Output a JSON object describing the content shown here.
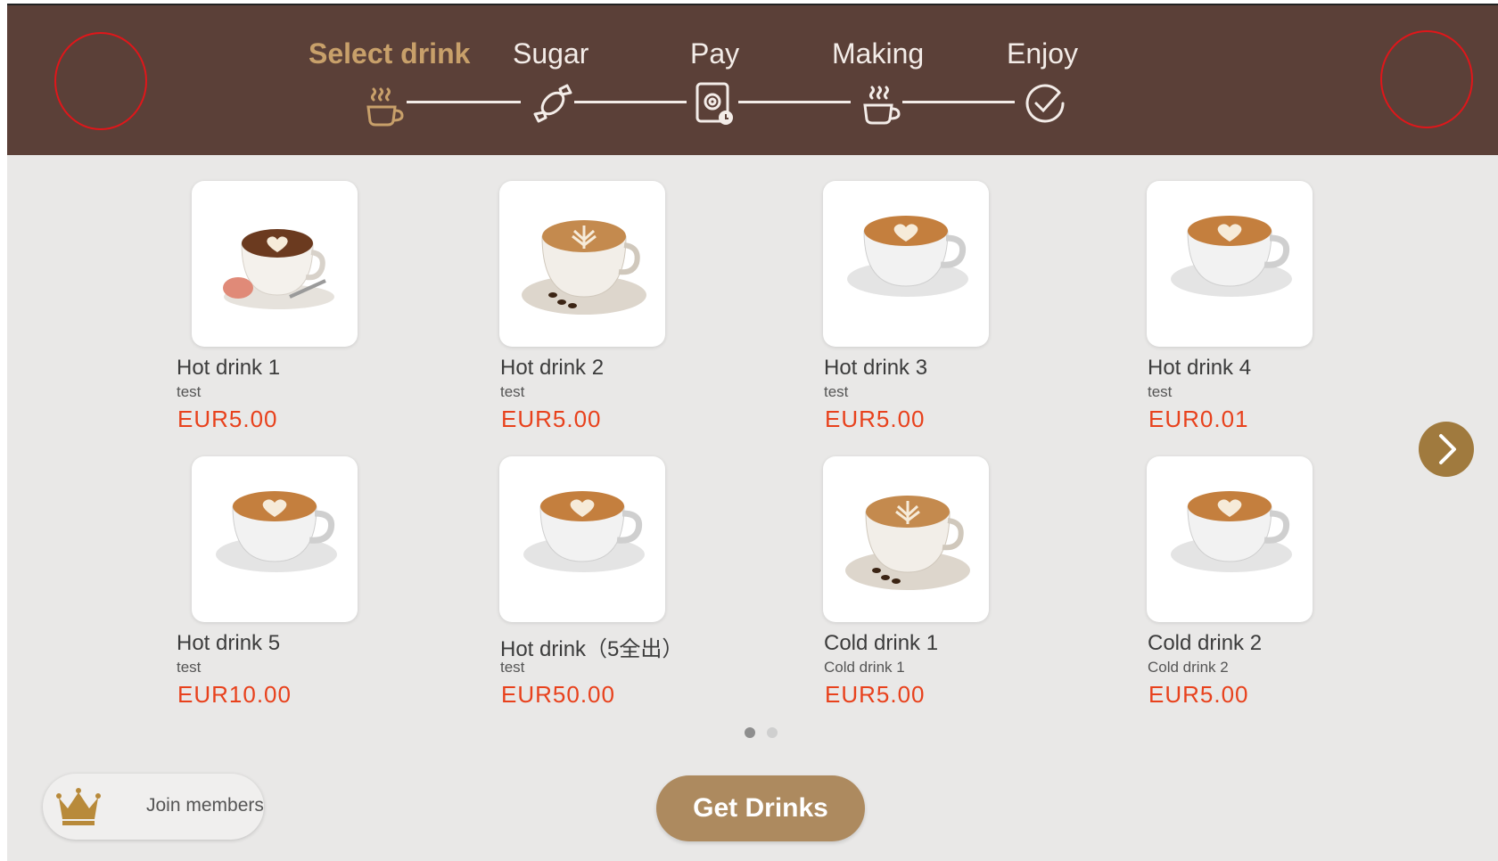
{
  "steps": [
    {
      "label": "Select drink",
      "icon": "steaming-cup-icon",
      "active": true
    },
    {
      "label": "Sugar",
      "icon": "candy-icon",
      "active": false
    },
    {
      "label": "Pay",
      "icon": "payment-scan-icon",
      "active": false
    },
    {
      "label": "Making",
      "icon": "brewing-cup-icon",
      "active": false
    },
    {
      "label": "Enjoy",
      "icon": "check-circle-icon",
      "active": false
    }
  ],
  "products": [
    {
      "name": "Hot drink 1",
      "desc": "test",
      "price": "EUR5.00",
      "image": "latte-heart-with-macaron"
    },
    {
      "name": "Hot drink 2",
      "desc": "test",
      "price": "EUR5.00",
      "image": "latte-fern-with-beans"
    },
    {
      "name": "Hot drink 3",
      "desc": "test",
      "price": "EUR5.00",
      "image": "latte-heart-white-cup"
    },
    {
      "name": "Hot drink 4",
      "desc": "test",
      "price": "EUR0.01",
      "image": "latte-heart-white-cup"
    },
    {
      "name": "Hot drink 5",
      "desc": "test",
      "price": "EUR10.00",
      "image": "latte-heart-white-cup"
    },
    {
      "name": "Hot drink（5全出）",
      "desc": "test",
      "price": "EUR50.00",
      "image": "latte-heart-white-cup"
    },
    {
      "name": "Cold drink 1",
      "desc": "Cold drink 1",
      "price": "EUR5.00",
      "image": "latte-fern-with-beans"
    },
    {
      "name": "Cold drink 2",
      "desc": "Cold drink 2",
      "price": "EUR5.00",
      "image": "latte-heart-white-cup"
    }
  ],
  "pagination": {
    "pages": 2,
    "current": 1
  },
  "next_icon": "chevron-right-icon",
  "members": {
    "label": "Join members",
    "icon": "crown-icon"
  },
  "get_drinks": {
    "label": "Get Drinks"
  },
  "colors": {
    "header_bg": "#5b4038",
    "active_step": "#c8a06a",
    "price": "#e8411c",
    "button_gold": "#ad8a5f",
    "next_button": "#a07a3e",
    "highlight_circle": "#e0161a"
  }
}
